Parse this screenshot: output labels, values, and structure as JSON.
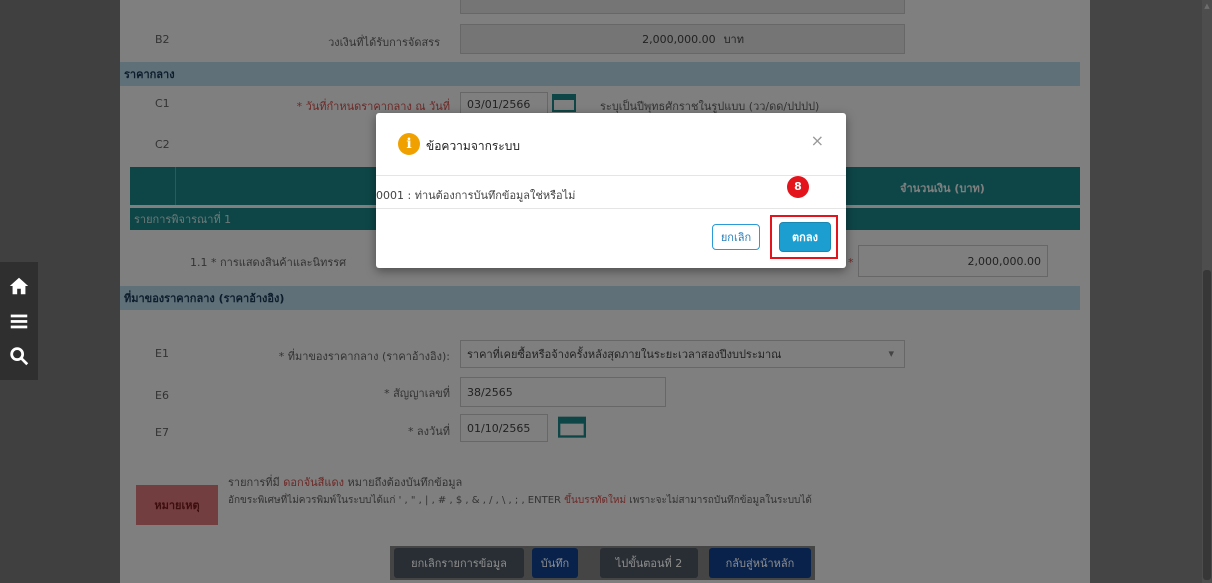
{
  "form": {
    "b2": {
      "code": "B2",
      "label": "วงเงินที่ได้รับการจัดสรร",
      "value": "2,000,000.00",
      "unit": "บาท"
    },
    "section_reference_price": "ราคากลาง",
    "c1": {
      "code": "C1",
      "label": "* วันที่กำหนดราคากลาง ณ วันที่",
      "value": "03/01/2566",
      "hint": "ระบุเป็นปีพุทธศักราชในรูปแบบ (วว/ดด/ปปปป)"
    },
    "c2": {
      "code": "C2"
    },
    "table_header_amount": "จำนวนเงิน (บาท)",
    "table_subheader": "รายการพิจารณาที่ 1",
    "item_1_1": {
      "label": "1.1 * การแสดงสินค้าและนิทรรศ",
      "value": "2,000,000.00"
    },
    "section_source": "ที่มาของราคากลาง (ราคาอ้างอิง)",
    "e1": {
      "code": "E1",
      "label": "* ที่มาของราคากลาง (ราคาอ้างอิง):",
      "value": "ราคาที่เคยซื้อหรือจ้างครั้งหลังสุดภายในระยะเวลาสองปีงบประมาณ"
    },
    "e6": {
      "code": "E6",
      "label": "* สัญญาเลขที่",
      "value": "38/2565"
    },
    "e7": {
      "code": "E7",
      "label": "* ลงวันที่",
      "value": "01/10/2565"
    },
    "note": {
      "badge": "หมายเหตุ",
      "line1_prefix": "รายการที่มี",
      "line1_red": "ดอกจันสีแดง",
      "line1_suffix": "หมายถึงต้องบันทึกข้อมูล",
      "line2_prefix": "อักขระพิเศษที่ไม่ควรพิมพ์ในระบบได้แก่ ' , \" , | , # , $ , & , / , \\ , ; , ENTER",
      "line2_red": "ขึ้นบรรทัดใหม่",
      "line2_suffix": "เพราะจะไม่สามารถบันทึกข้อมูลในระบบได้"
    },
    "buttons": {
      "cancel_item": "ยกเลิกรายการข้อมูล",
      "save": "บันทึก",
      "next_step": "ไปขั้นตอนที่ 2",
      "back_home": "กลับสู่หน้าหลัก"
    }
  },
  "modal": {
    "title": "ข้อความจากระบบ",
    "close": "×",
    "message": "0001 : ท่านต้องการบันทึกข้อมูลใช่หรือไม่",
    "cancel_label": "ยกเลิก",
    "ok_label": "ตกลง",
    "step_number": "8"
  },
  "colors": {
    "teal": "#1c8d8f",
    "section_blue": "#bfe0f2",
    "highlight_red": "#e3141b",
    "primary_blue": "#1c9fd0"
  },
  "icons": [
    "home-icon",
    "menu-icon",
    "search-icon",
    "calendar-icon",
    "info-icon",
    "close-icon",
    "chevron-down-icon"
  ]
}
